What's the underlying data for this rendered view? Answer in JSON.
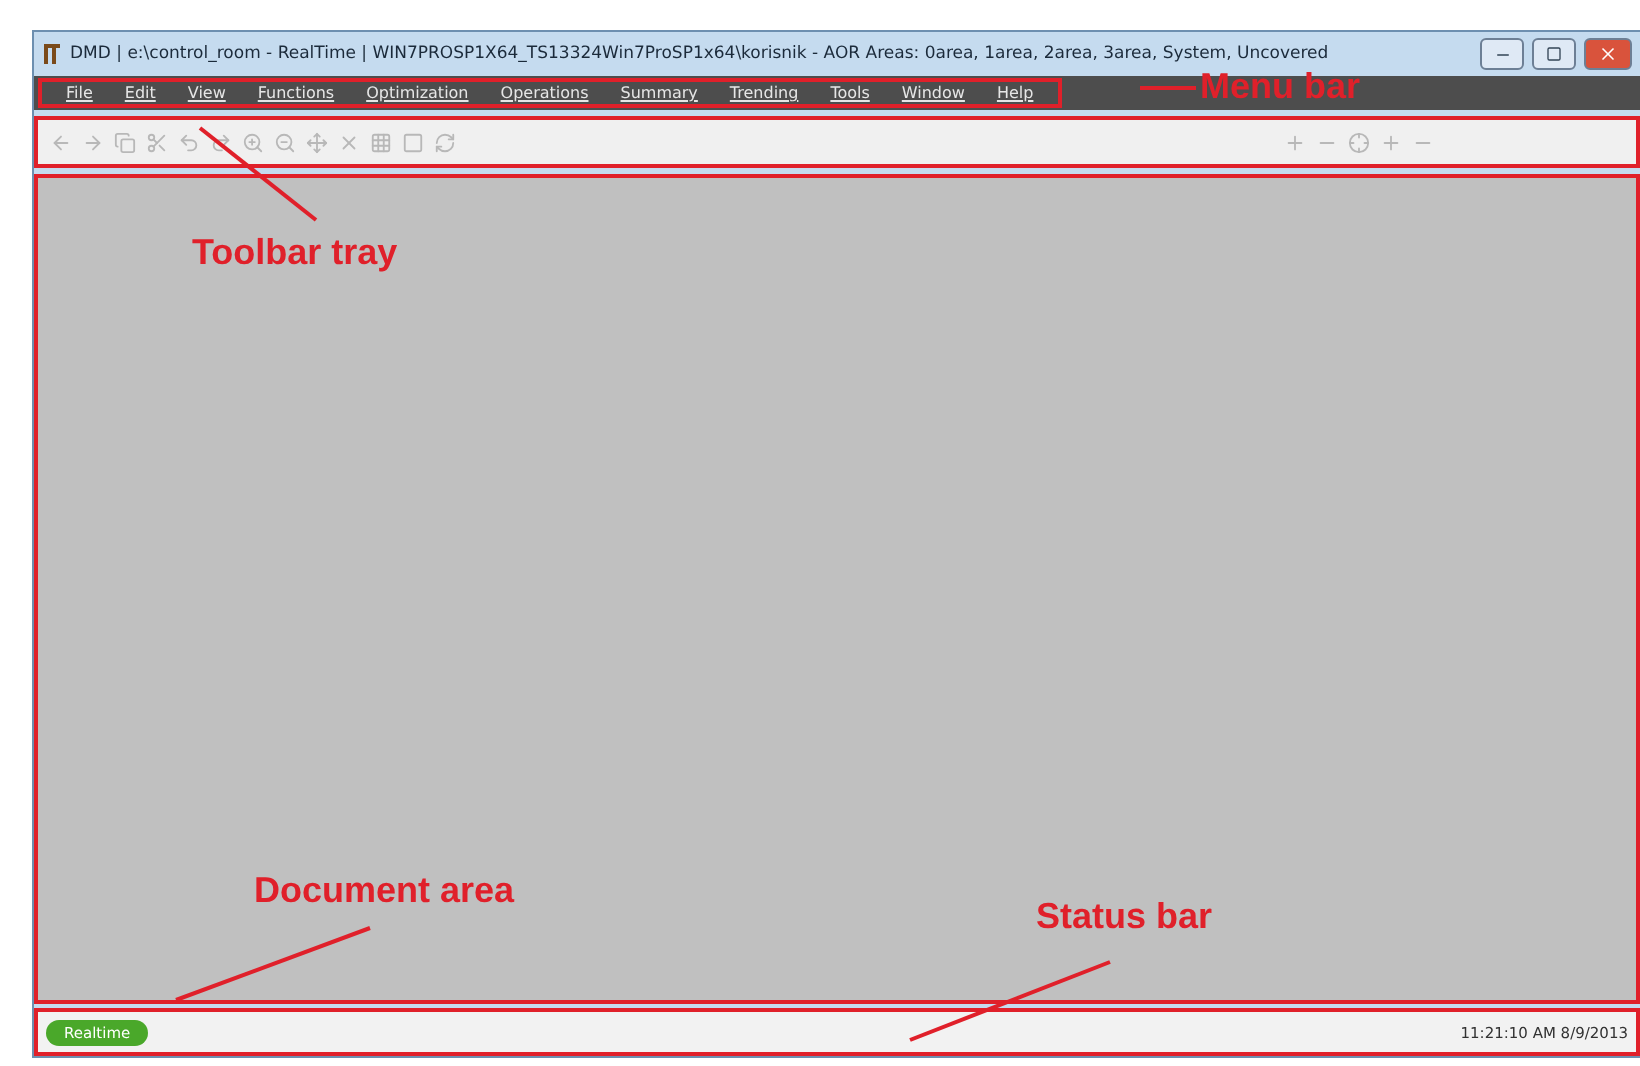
{
  "window": {
    "title": "DMD | e:\\control_room - RealTime | WIN7PROSP1X64_TS13324Win7ProSP1x64\\korisnik - AOR Areas: 0area, 1area, 2area, 3area, System, Uncovered"
  },
  "menu_bar": [
    "File",
    "Edit",
    "View",
    "Functions",
    "Optimization",
    "Operations",
    "Summary",
    "Trending",
    "Tools",
    "Window",
    "Help"
  ],
  "status_bar": {
    "mode": "Realtime",
    "datetime": "11:21:10 AM 8/9/2013"
  },
  "annotations": [
    {
      "kind": "menu",
      "label": "Menu bar"
    },
    {
      "kind": "toolbar",
      "label": "Toolbar tray"
    },
    {
      "kind": "document",
      "label": "Document area"
    },
    {
      "kind": "status",
      "label": "Status bar"
    }
  ]
}
